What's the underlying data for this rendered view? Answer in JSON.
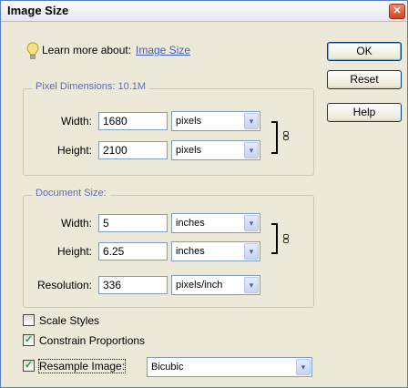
{
  "window": {
    "title": "Image Size",
    "close_glyph": "✕"
  },
  "learn_more": {
    "label": "Learn more about:",
    "link": "Image Size"
  },
  "buttons": {
    "ok": "OK",
    "reset": "Reset",
    "help": "Help"
  },
  "pixel_dimensions": {
    "title": "Pixel Dimensions:  10.1M",
    "width": {
      "label": "Width:",
      "value": "1680",
      "unit": "pixels"
    },
    "height": {
      "label": "Height:",
      "value": "2100",
      "unit": "pixels"
    }
  },
  "document_size": {
    "title": "Document Size:",
    "width": {
      "label": "Width:",
      "value": "5",
      "unit": "inches"
    },
    "height": {
      "label": "Height:",
      "value": "6.25",
      "unit": "inches"
    },
    "resolution": {
      "label": "Resolution:",
      "value": "336",
      "unit": "pixels/inch"
    }
  },
  "options": {
    "scale_styles": {
      "label": "Scale Styles",
      "checked": false
    },
    "constrain_proportions": {
      "label": "Constrain Proportions",
      "checked": true
    },
    "resample_image": {
      "label": "Resample Image:",
      "checked": true,
      "method": "Bicubic"
    }
  },
  "icons": {
    "dropdown_arrow": "▾",
    "check_mark": "✓"
  }
}
